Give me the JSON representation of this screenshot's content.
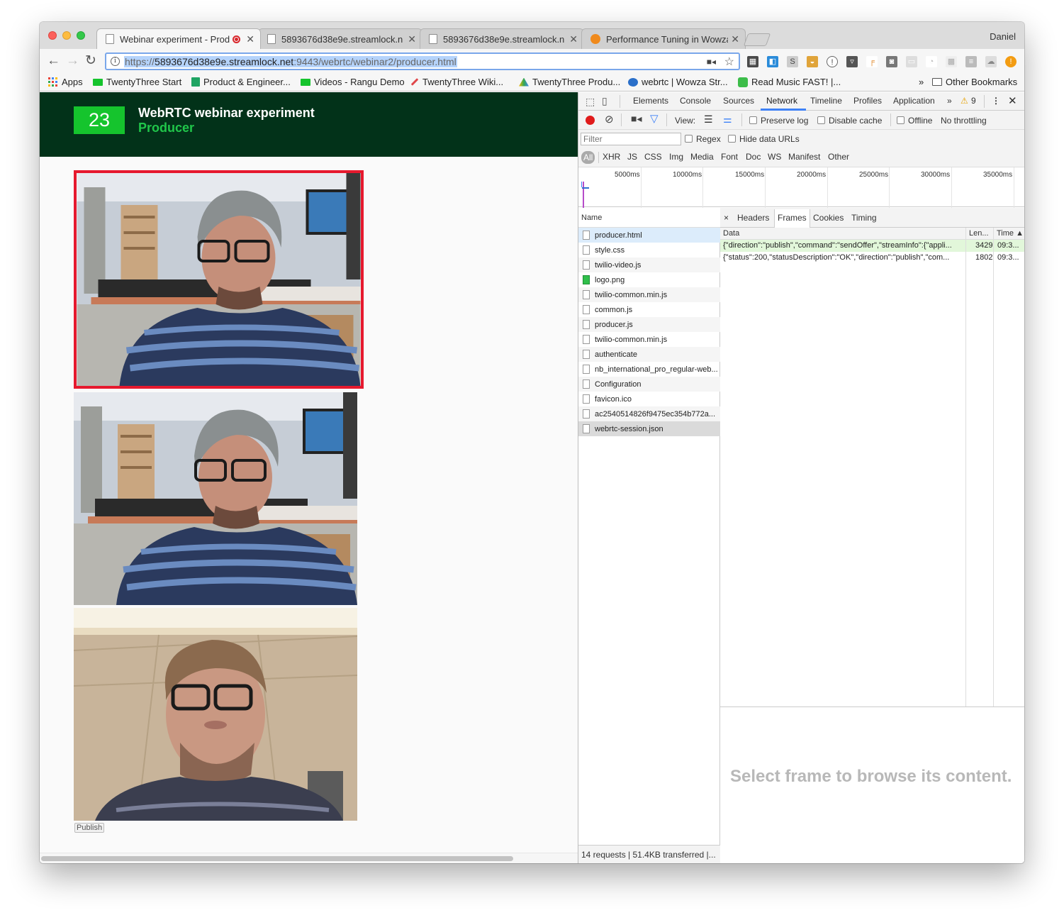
{
  "browser": {
    "profile_name": "Daniel",
    "tabs": [
      {
        "title": "Webinar experiment - Produ",
        "active": true,
        "recording": true
      },
      {
        "title": "5893676d38e9e.streamlock.n",
        "active": false
      },
      {
        "title": "5893676d38e9e.streamlock.n",
        "active": false
      },
      {
        "title": "Performance Tuning in Wowza",
        "active": false
      }
    ],
    "url": {
      "scheme": "https://",
      "host": "5893676d38e9e.streamlock.net",
      "rest": ":9443/webrtc/webinar2/producer.html"
    },
    "bookmarks": [
      {
        "label": "Apps",
        "icon": "apps-grid-icon"
      },
      {
        "label": "TwentyThree Start",
        "icon": "twentythree-icon"
      },
      {
        "label": "Product & Engineer...",
        "icon": "sheets-icon"
      },
      {
        "label": "Videos - Rangu Demo",
        "icon": "twentythree-icon"
      },
      {
        "label": "TwentyThree Wiki...",
        "icon": "feather-icon"
      },
      {
        "label": "TwentyThree Produ...",
        "icon": "drive-icon"
      },
      {
        "label": "webrtc | Wowza Str...",
        "icon": "wowza-icon"
      },
      {
        "label": "Read Music FAST! |...",
        "icon": "udemy-icon"
      }
    ],
    "other_bookmarks": "Other Bookmarks",
    "overflow": "»"
  },
  "page": {
    "logo_text": "23",
    "title": "WebRTC webinar experiment",
    "subtitle": "Producer",
    "publish_label": "Publish",
    "colors": {
      "header_bg": "#023219",
      "logo_green": "#15c42d",
      "subtitle_green": "#20c64a",
      "selected_border": "#e6192e"
    }
  },
  "devtools": {
    "panel_tabs": [
      "Elements",
      "Console",
      "Sources",
      "Network",
      "Timeline",
      "Profiles",
      "Application"
    ],
    "active_panel": "Network",
    "more": "»",
    "warning_count": "9",
    "toolbar": {
      "view_label": "View:",
      "preserve_log": "Preserve log",
      "disable_cache": "Disable cache",
      "offline": "Offline",
      "throttling": "No throttling"
    },
    "filter": {
      "placeholder": "Filter",
      "regex": "Regex",
      "hide_data_urls": "Hide data URLs"
    },
    "types": [
      "All",
      "XHR",
      "JS",
      "CSS",
      "Img",
      "Media",
      "Font",
      "Doc",
      "WS",
      "Manifest",
      "Other"
    ],
    "timeline_labels": [
      "5000ms",
      "10000ms",
      "15000ms",
      "20000ms",
      "25000ms",
      "30000ms",
      "35000ms"
    ],
    "name_header": "Name",
    "requests": [
      "producer.html",
      "style.css",
      "twilio-video.js",
      "logo.png",
      "twilio-common.min.js",
      "common.js",
      "producer.js",
      "twilio-common.min.js",
      "authenticate",
      "nb_international_pro_regular-web...",
      "Configuration",
      "favicon.ico",
      "ac2540514826f9475ec354b772a...",
      "webrtc-session.json"
    ],
    "status": "14 requests | 51.4KB transferred |...",
    "detail_tabs": [
      "Headers",
      "Frames",
      "Cookies",
      "Timing"
    ],
    "detail_close": "×",
    "frames_columns": {
      "data": "Data",
      "length": "Len...",
      "time": "Time ▲"
    },
    "frames": [
      {
        "data": "{\"direction\":\"publish\",\"command\":\"sendOffer\",\"streamInfo\":{\"appli...",
        "length": "3429",
        "time": "09:3..."
      },
      {
        "data": "{\"status\":200,\"statusDescription\":\"OK\",\"direction\":\"publish\",\"com...",
        "length": "1802",
        "time": "09:3..."
      }
    ],
    "frame_placeholder": "Select frame to browse its content."
  }
}
